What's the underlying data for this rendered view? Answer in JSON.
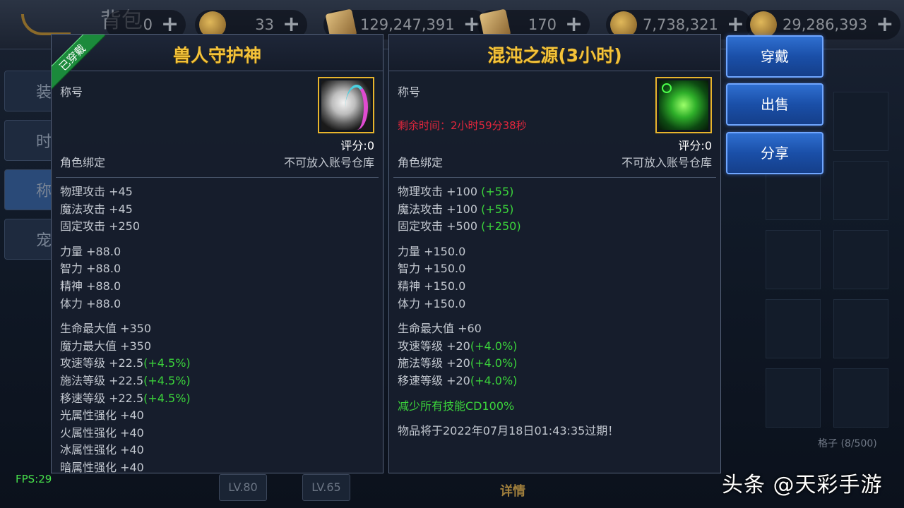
{
  "topbar": {
    "title": "背包",
    "currencies": [
      {
        "value": "0",
        "icon": "gold-coin-icon"
      },
      {
        "value": "33",
        "icon": "coin-icon"
      },
      {
        "value": "129,247,391",
        "icon": "scroll-icon"
      },
      {
        "value": "170",
        "icon": "scroll-icon"
      },
      {
        "value": "7,738,321",
        "icon": "coin-icon"
      },
      {
        "value": "29,286,393",
        "icon": "coin-icon"
      }
    ],
    "plus": "+"
  },
  "side_tabs": [
    "装",
    "时",
    "称",
    "宠"
  ],
  "left_panel": {
    "title": "兽人守护神",
    "ribbon": "已穿戴",
    "type": "称号",
    "score": "评分:0",
    "bind": "角色绑定",
    "storage": "不可放入账号仓库",
    "stats": [
      [
        "物理攻击 +45",
        "魔法攻击 +45",
        "固定攻击 +250"
      ],
      [
        "力量 +88.0",
        "智力 +88.0",
        "精神 +88.0",
        "体力 +88.0"
      ],
      [
        "生命最大值 +350",
        "魔力最大值 +350"
      ]
    ],
    "pct_stats": [
      {
        "base": "攻速等级 +22.5",
        "bonus": "(+4.5%)"
      },
      {
        "base": "施法等级 +22.5",
        "bonus": "(+4.5%)"
      },
      {
        "base": "移速等级 +22.5",
        "bonus": "(+4.5%)"
      }
    ],
    "element_stats": [
      "光属性强化 +40",
      "火属性强化 +40",
      "冰属性强化 +40",
      "暗属性强化 +40"
    ]
  },
  "right_panel": {
    "title": "混沌之源(3小时)",
    "type": "称号",
    "remaining": "剩余时间：2小时59分38秒",
    "score": "评分:0",
    "bind": "角色绑定",
    "storage": "不可放入账号仓库",
    "attack": [
      {
        "base": "物理攻击 +100",
        "bonus": "(+55)"
      },
      {
        "base": "魔法攻击 +100",
        "bonus": "(+55)"
      },
      {
        "base": "固定攻击 +500",
        "bonus": "(+250)"
      }
    ],
    "attrs": [
      "力量 +150.0",
      "智力 +150.0",
      "精神 +150.0",
      "体力 +150.0"
    ],
    "hp": "生命最大值 +60",
    "pct_stats": [
      {
        "base": "攻速等级 +20",
        "bonus": "(+4.0%)"
      },
      {
        "base": "施法等级 +20",
        "bonus": "(+4.0%)"
      },
      {
        "base": "移速等级 +20",
        "bonus": "(+4.0%)"
      }
    ],
    "cd": "减少所有技能CD100%",
    "expire": "物品将于2022年07月18日01:43:35过期！"
  },
  "actions": {
    "equip": "穿戴",
    "sell": "出售",
    "share": "分享"
  },
  "bottom": {
    "lv1": "LV.80",
    "lv2": "LV.65",
    "detail": "详情",
    "slots": "格子 (8/500)"
  },
  "fps": "FPS:29",
  "watermark": "头条 @天彩手游",
  "colors": {
    "title_gold": "#f3c23a",
    "bonus_green": "#3bd43b",
    "timer_red": "#e0263c",
    "button_blue": "#1a4fa8"
  }
}
